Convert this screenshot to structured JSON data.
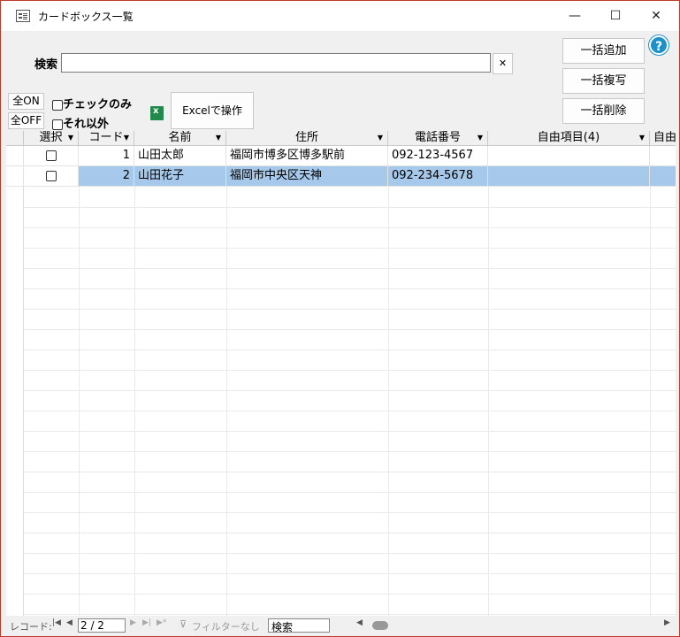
{
  "window": {
    "title": "カードボックス一覧",
    "minimize": "—",
    "maximize": "☐",
    "close": "✕"
  },
  "search": {
    "label": "検索",
    "value": "",
    "clear_label": "✕"
  },
  "actions": {
    "bulk_add": "一括追加",
    "bulk_copy": "一括複写",
    "bulk_delete": "一括削除",
    "help": "?"
  },
  "filters": {
    "all_on": "全ON",
    "all_off": "全OFF",
    "checked_only": "チェックのみ",
    "others": "それ以外",
    "excel": "Excelで操作"
  },
  "table": {
    "columns": [
      "選択",
      "コード",
      "名前",
      "住所",
      "電話番号",
      "自由項目(4)",
      "自由"
    ],
    "rows": [
      {
        "checked": false,
        "code": "1",
        "name": "山田太郎",
        "address": "福岡市博多区博多駅前",
        "phone": "092-123-4567",
        "free4": "",
        "selected": false
      },
      {
        "checked": false,
        "code": "2",
        "name": "山田花子",
        "address": "福岡市中央区天神",
        "phone": "092-234-5678",
        "free4": "",
        "selected": true
      }
    ]
  },
  "status": {
    "record_label": "レコード:",
    "position": "2 / 2",
    "filter": "フィルターなし",
    "search": "検索"
  },
  "colors": {
    "selected_row": "#a6c8ea",
    "window_border": "#c0392b",
    "help_icon": "#1e90c8",
    "excel_icon": "#1f8a4c"
  }
}
